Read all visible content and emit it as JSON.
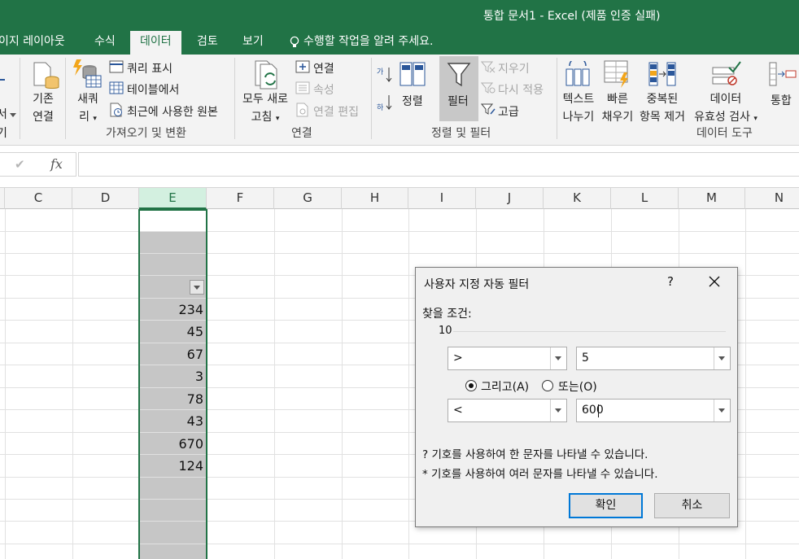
{
  "window": {
    "title": "통합 문서1 - Excel (제품 인증 실패)"
  },
  "tabs": [
    {
      "label": "이지 레이아웃",
      "active": false
    },
    {
      "label": "수식",
      "active": false
    },
    {
      "label": "데이터",
      "active": true
    },
    {
      "label": "검토",
      "active": false
    },
    {
      "label": "보기",
      "active": false
    }
  ],
  "tell_me": "수행할 작업을 알려 주세요.",
  "ribbon": {
    "partial_left": {
      "line1": "서",
      "line2": "기"
    },
    "existing_connections": {
      "line1": "기존",
      "line2": "연결"
    },
    "new_query": {
      "line1": "새쿼",
      "line2": "리"
    },
    "show_queries": "쿼리 표시",
    "from_table": "테이블에서",
    "recent_sources": "최근에 사용한 원본",
    "group_get_transform": "가져오기 및 변환",
    "refresh_all": {
      "line1": "모두 새로",
      "line2": "고침"
    },
    "connections": "연결",
    "properties": "속성",
    "edit_links": "연결 편집",
    "group_connections": "연결",
    "sort_az_icon": "sort-ascending-icon",
    "sort": "정렬",
    "filter": "필터",
    "clear": "지우기",
    "reapply": "다시 적용",
    "advanced": "고급",
    "group_sort_filter": "정렬 및 필터",
    "text_to_columns": {
      "line1": "텍스트",
      "line2": "나누기"
    },
    "flash_fill": {
      "line1": "빠른",
      "line2": "채우기"
    },
    "remove_duplicates": {
      "line1": "중복된",
      "line2": "항목 제거"
    },
    "data_validation": {
      "line1": "데이터",
      "line2": "유효성 검사"
    },
    "consolidate": "통합",
    "group_data_tools": "데이터 도구"
  },
  "formula_bar": {
    "check": "✔",
    "fx": "fx",
    "value": ""
  },
  "columns": [
    "C",
    "D",
    "E",
    "F",
    "G",
    "H",
    "I",
    "J",
    "K",
    "L",
    "M",
    "N"
  ],
  "selected_column": "E",
  "cells_E": [
    "234",
    "45",
    "67",
    "3",
    "78",
    "43",
    "670",
    "124"
  ],
  "dialog": {
    "title": "사용자 지정 자동 필터",
    "help": "?",
    "find_label": "찾을 조건:",
    "field_name": "10",
    "op1": ">",
    "val1": "5",
    "and_label": "그리고(A)",
    "or_label": "또는(O)",
    "and_selected": true,
    "op2": "<",
    "val2": "600",
    "hint1": "? 기호를 사용하여 한 문자를 나타낼 수 있습니다.",
    "hint2": "* 기호를 사용하여 여러 문자를 나타낼 수 있습니다.",
    "ok": "확인",
    "cancel": "취소"
  },
  "colors": {
    "excel_green": "#217346",
    "ribbon_bg": "#f3f3f3",
    "selection_fill": "#c6c6c6",
    "dialog_accent": "#0078d7"
  }
}
